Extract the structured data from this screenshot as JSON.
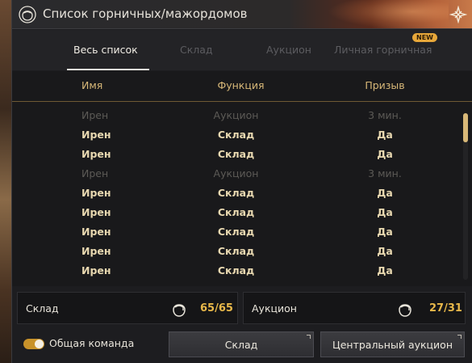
{
  "window": {
    "title": "Список горничных/мажордомов",
    "icon": "maid-head-icon",
    "close_icon": "close-ornament-icon"
  },
  "tabs": [
    {
      "label": "Весь список",
      "active": true
    },
    {
      "label": "Склад",
      "active": false
    },
    {
      "label": "Аукцион",
      "active": false
    },
    {
      "label": "Личная горничная",
      "active": false,
      "badge": "NEW"
    }
  ],
  "table": {
    "headers": {
      "name": "Имя",
      "function": "Функция",
      "summon": "Призыв"
    },
    "rows": [
      {
        "name": "Ирен",
        "function": "Аукцион",
        "summon": "3 мин.",
        "available": false
      },
      {
        "name": "Ирен",
        "function": "Склад",
        "summon": "Да",
        "available": true
      },
      {
        "name": "Ирен",
        "function": "Склад",
        "summon": "Да",
        "available": true
      },
      {
        "name": "Ирен",
        "function": "Аукцион",
        "summon": "3 мин.",
        "available": false
      },
      {
        "name": "Ирен",
        "function": "Склад",
        "summon": "Да",
        "available": true
      },
      {
        "name": "Ирен",
        "function": "Склад",
        "summon": "Да",
        "available": true
      },
      {
        "name": "Ирен",
        "function": "Склад",
        "summon": "Да",
        "available": true
      },
      {
        "name": "Ирен",
        "function": "Склад",
        "summon": "Да",
        "available": true
      },
      {
        "name": "Ирен",
        "function": "Склад",
        "summon": "Да",
        "available": true
      }
    ]
  },
  "stats": {
    "storage": {
      "label": "Склад",
      "value": "65/65"
    },
    "auction": {
      "label": "Аукцион",
      "value": "27/31"
    }
  },
  "footer": {
    "toggle_label": "Общая команда",
    "toggle_on": true,
    "storage_button": "Склад",
    "auction_button": "Центральный аукцион"
  },
  "colors": {
    "accent_gold": "#e8b84a",
    "header_gold": "#d8b878",
    "badge": "#e8a83a"
  }
}
